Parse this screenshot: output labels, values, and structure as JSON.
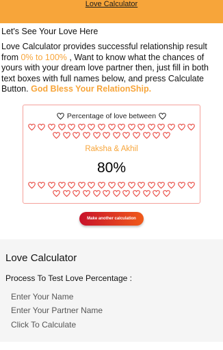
{
  "header": {
    "link_label": "Love Calculator"
  },
  "intro": {
    "heading": "Let's See Your Love Here",
    "text_part1": "Love Calculator provides successful relationship result from ",
    "highlight_range": "0% to 100%",
    "text_part2": " , Want to know what the chances of yours with your dream love partner then, just fill in both text boxes with full names below, and press Calculate Button. ",
    "blessing": "God Bless Your RelationShip."
  },
  "result": {
    "heading": "Percentage of love between",
    "names": "Raksha & Akhil",
    "percentage": "80%",
    "heart_color": "#e8453c",
    "heart_icon": "heart-outline-icon"
  },
  "again_button": {
    "label": "Make another calculation"
  },
  "calculator": {
    "title": "Love Calculator",
    "subtitle": "Process To Test Love Percentage :",
    "name_placeholder": "Enter Your Name",
    "partner_placeholder": "Enter Your Partner Name",
    "calculate_label": "Click To Calculate"
  },
  "colors": {
    "accent": "#f7a53a",
    "button_start": "#c8122b",
    "button_end": "#f05a1a"
  }
}
